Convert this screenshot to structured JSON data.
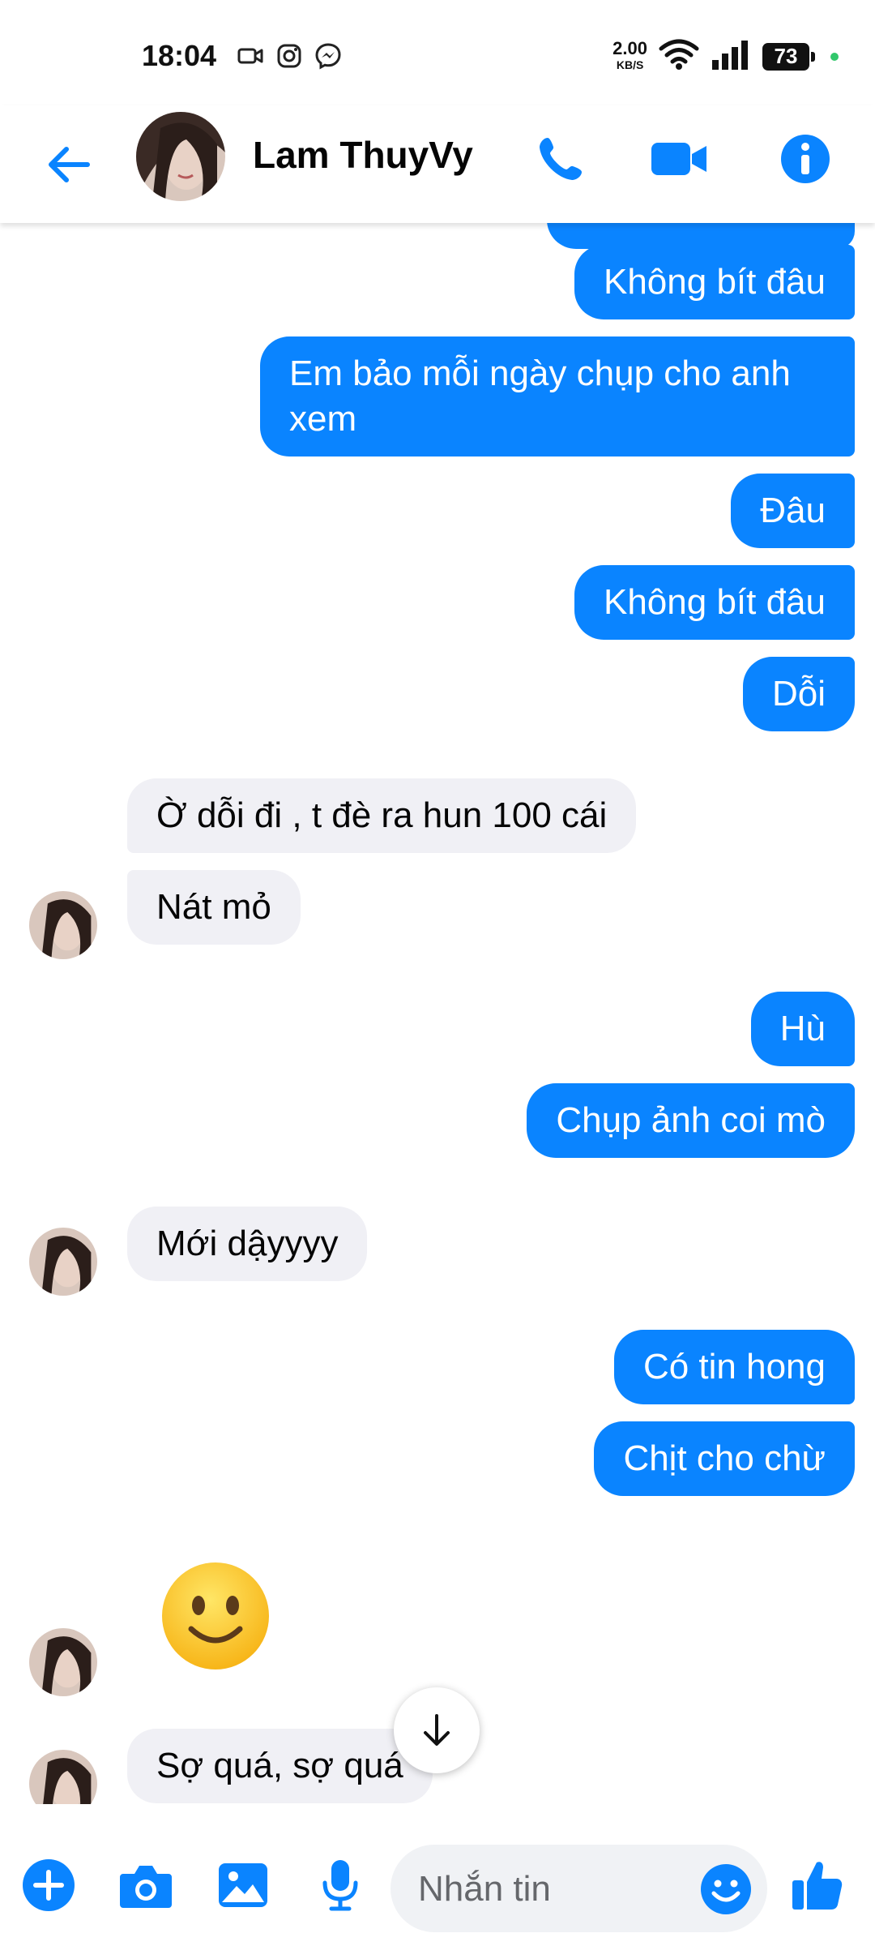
{
  "status_bar": {
    "time": "18:04",
    "net_speed_value": "2.00",
    "net_speed_unit": "KB/S",
    "battery": "73",
    "icons": [
      "video-camera-icon",
      "instagram-icon",
      "messenger-icon",
      "wifi-icon",
      "signal-icon"
    ]
  },
  "header": {
    "contact_name": "Lam ThuyVy",
    "icons": [
      "back-arrow-icon",
      "phone-icon",
      "video-call-icon",
      "info-icon"
    ]
  },
  "messages": [
    {
      "side": "out",
      "text": "Không bít đâu"
    },
    {
      "side": "out",
      "text": "Em bảo mỗi ngày chụp cho anh"
    },
    {
      "side": "out",
      "text": "xem"
    },
    {
      "side": "out",
      "text": "Đâu"
    },
    {
      "side": "out",
      "text": "Không bít đâu"
    },
    {
      "side": "out",
      "text": "Dỗi"
    },
    {
      "side": "in",
      "text": "Ờ dỗi đi , t đè ra hun 100 cái"
    },
    {
      "side": "in",
      "text": "Nát mỏ"
    },
    {
      "side": "out",
      "text": "Hù"
    },
    {
      "side": "out",
      "text": "Chụp ảnh coi mò"
    },
    {
      "side": "in",
      "text": "Mới dậyyyy"
    },
    {
      "side": "out",
      "text": "Có tin hong"
    },
    {
      "side": "out",
      "text": "Chịt cho chừ"
    },
    {
      "side": "in",
      "type": "emoji",
      "icon": "slightly-smiling-face-emoji"
    },
    {
      "side": "in",
      "text": "Sợ quá, sợ quá"
    }
  ],
  "composer": {
    "placeholder": "Nhắn tin",
    "icons": [
      "plus-icon",
      "camera-icon",
      "gallery-icon",
      "microphone-icon",
      "emoji-icon",
      "thumbs-up-icon"
    ]
  },
  "colors": {
    "accent": "#0a84ff",
    "incoming_bubble": "#f0f0f5",
    "outgoing_text": "#ffffff"
  }
}
